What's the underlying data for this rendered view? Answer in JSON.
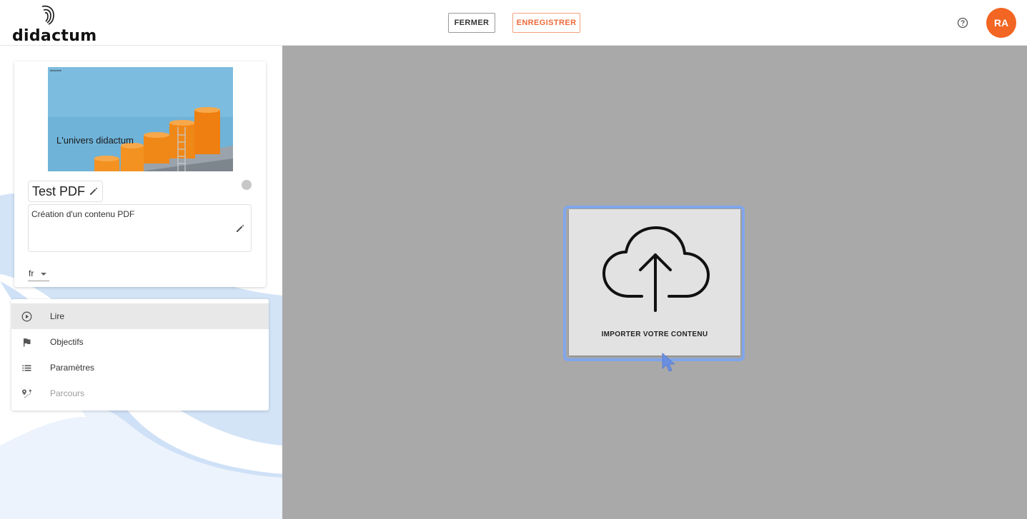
{
  "header": {
    "logo_text": "didactum",
    "close_label": "FERMER",
    "save_label": "ENREGISTRER",
    "help_icon": "help-circle-icon",
    "avatar_initials": "RA",
    "avatar_color": "#f26522",
    "save_color": "#ee6a3a"
  },
  "card": {
    "thumbnail": {
      "brand": "didactum",
      "caption": "L'univers didactum"
    },
    "title": "Test PDF",
    "description": "Création d'un contenu PDF",
    "language": "fr"
  },
  "menu": {
    "items": [
      {
        "label": "Lire",
        "icon": "play-circle-icon",
        "active": true
      },
      {
        "label": "Objectifs",
        "icon": "flag-icon"
      },
      {
        "label": "Paramètres",
        "icon": "list-icon"
      },
      {
        "label": "Parcours",
        "icon": "route-icon",
        "disabled": true
      }
    ]
  },
  "upload": {
    "label": "IMPORTER VOTRE CONTENU",
    "icon": "cloud-upload-icon",
    "focus_color": "#80a6ec"
  }
}
